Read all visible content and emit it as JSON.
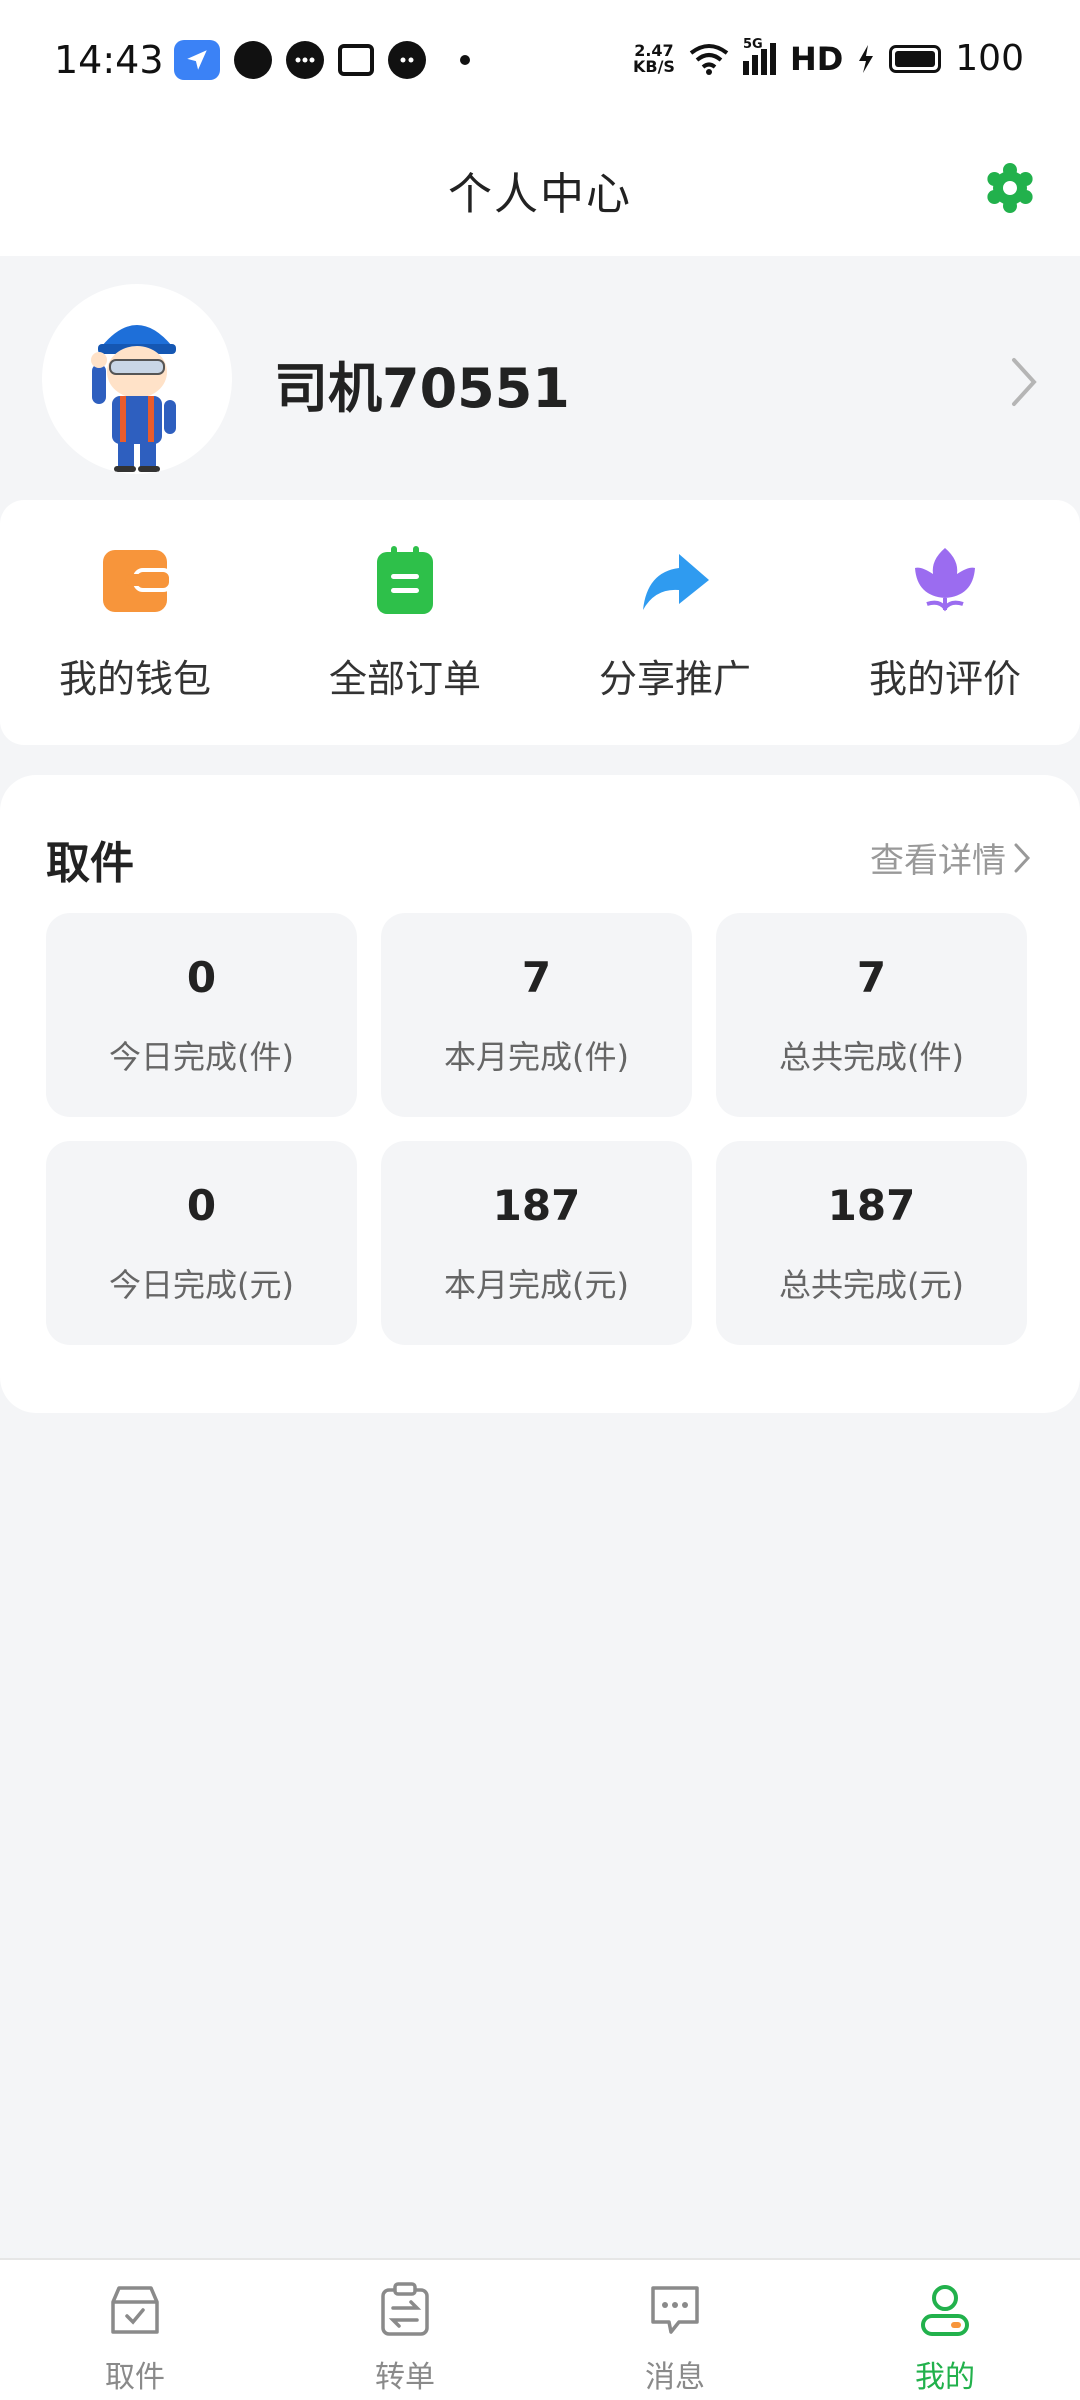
{
  "status_bar": {
    "time": "14:43",
    "net_speed_value": "2.47",
    "net_speed_unit": "KB/S",
    "network": "5G",
    "hd": "HD",
    "battery": "100"
  },
  "header": {
    "title": "个人中心"
  },
  "profile": {
    "username": "司机70551"
  },
  "actions": [
    {
      "label": "我的钱包",
      "icon": "wallet-icon",
      "color": "#f7953b"
    },
    {
      "label": "全部订单",
      "icon": "orders-icon",
      "color": "#2ec04a"
    },
    {
      "label": "分享推广",
      "icon": "share-icon",
      "color": "#2f9bf0"
    },
    {
      "label": "我的评价",
      "icon": "review-icon",
      "color": "#9b6cf0"
    }
  ],
  "stats": {
    "title": "取件",
    "more": "查看详情",
    "items": [
      {
        "value": "0",
        "label": "今日完成(件)"
      },
      {
        "value": "7",
        "label": "本月完成(件)"
      },
      {
        "value": "7",
        "label": "总共完成(件)"
      },
      {
        "value": "0",
        "label": "今日完成(元)"
      },
      {
        "value": "187",
        "label": "本月完成(元)"
      },
      {
        "value": "187",
        "label": "总共完成(元)"
      }
    ]
  },
  "bottom_nav": [
    {
      "label": "取件",
      "icon": "pickup-icon",
      "active": false
    },
    {
      "label": "转单",
      "icon": "transfer-icon",
      "active": false
    },
    {
      "label": "消息",
      "icon": "message-icon",
      "active": false
    },
    {
      "label": "我的",
      "icon": "profile-icon",
      "active": true
    }
  ],
  "colors": {
    "accent": "#22b14c",
    "background": "#f4f5f7",
    "card": "#ffffff"
  }
}
